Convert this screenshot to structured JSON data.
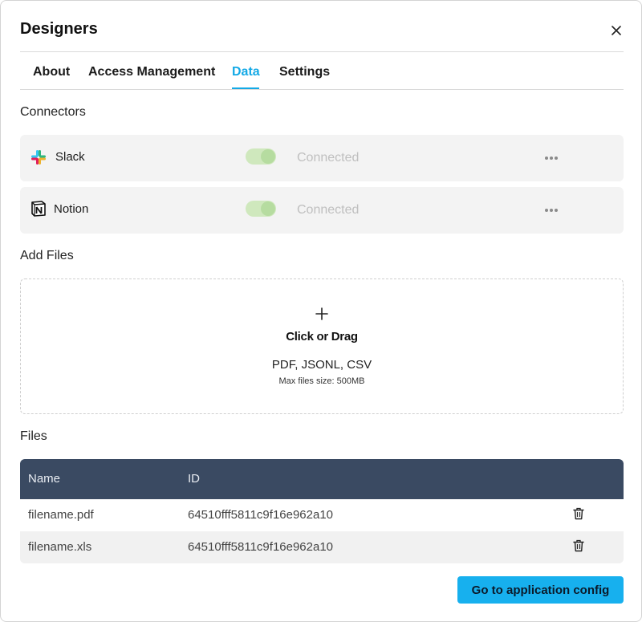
{
  "dialog": {
    "title": "Designers",
    "close_icon": "close-icon"
  },
  "tabs": [
    {
      "label": "About",
      "active": false
    },
    {
      "label": "Access Management",
      "active": false
    },
    {
      "label": "Data",
      "active": true
    },
    {
      "label": "Settings",
      "active": false
    }
  ],
  "connectors": {
    "heading": "Connectors",
    "items": [
      {
        "name": "Slack",
        "icon": "slack-icon",
        "enabled": true,
        "status": "Connected",
        "menu_icon": "more-dots-icon"
      },
      {
        "name": "Notion",
        "icon": "notion-icon",
        "enabled": true,
        "status": "Connected",
        "menu_icon": "more-dots-icon"
      }
    ]
  },
  "add_files": {
    "heading": "Add Files",
    "dropzone": {
      "icon": "plus-icon",
      "title": "Click or Drag",
      "types": "PDF, JSONL, CSV",
      "max_size": "Max files size: 500MB"
    }
  },
  "files": {
    "heading": "Files",
    "columns": [
      "Name",
      "ID"
    ],
    "rows": [
      {
        "name": "filename.pdf",
        "id": "64510fff5811c9f16e962a10",
        "action_icon": "trash-icon"
      },
      {
        "name": "filename.xls",
        "id": "64510fff5811c9f16e962a10",
        "action_icon": "trash-icon"
      }
    ]
  },
  "footer": {
    "primary_button": "Go to application config"
  },
  "colors": {
    "accent": "#13a9e6",
    "button_bg": "#17b0ee",
    "table_header_bg": "#3a4a62",
    "toggle_on": "#cfe8bd",
    "row_bg": "#f3f3f3"
  }
}
